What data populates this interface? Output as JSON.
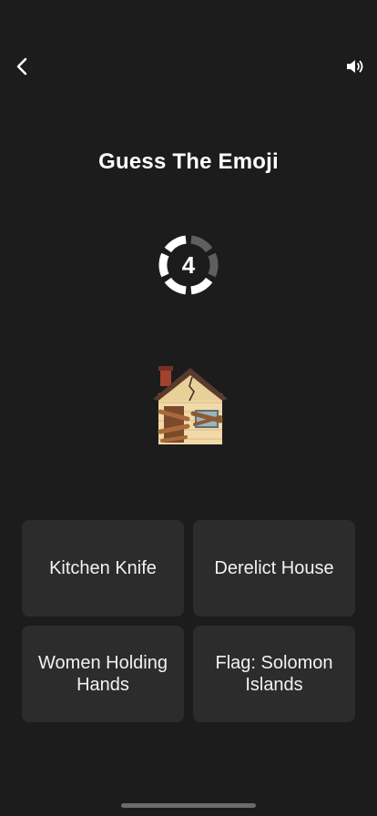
{
  "header": {
    "title": "Guess The Emoji",
    "back_icon": "chevron-left-icon",
    "sound_icon": "speaker-icon"
  },
  "timer": {
    "value": "4",
    "segments_total": 6,
    "segments_remaining": 4,
    "active_color": "#ffffff",
    "inactive_color": "#5f5f5f"
  },
  "puzzle": {
    "emoji_name": "derelict-house-emoji"
  },
  "options": [
    {
      "label": "Kitchen Knife"
    },
    {
      "label": "Derelict House"
    },
    {
      "label": "Women Holding Hands"
    },
    {
      "label": "Flag: Solomon Islands"
    }
  ],
  "colors": {
    "background": "#1c1c1c",
    "option_background": "#2c2c2c",
    "text": "#ffffff"
  }
}
